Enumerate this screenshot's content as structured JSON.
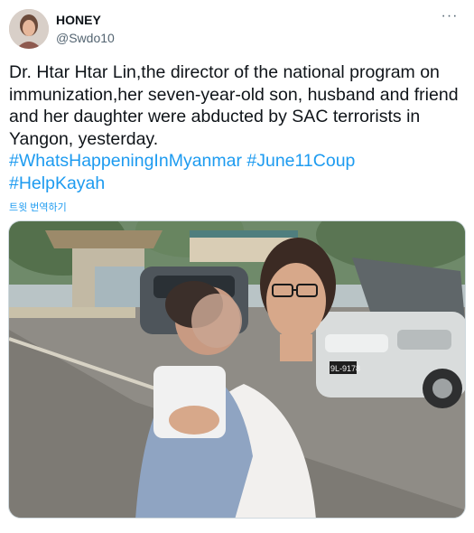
{
  "tweet": {
    "author_name": "HONEY",
    "author_handle": "@Swdo10",
    "more_icon": "more-horizontal-icon",
    "body_text": "Dr. Htar Htar Lin,the director of the national program on immunization,her seven-year-old son, husband and friend and her daughter were abducted by SAC terrorists in Yangon, yesterday.",
    "hashtags": [
      "#WhatsHappeningInMyanmar",
      "#June11Coup",
      "#HelpKayah"
    ],
    "translate_label": "트윗 번역하기",
    "media": {
      "plate_text": "9L-9178"
    }
  },
  "colors": {
    "link": "#1d9bf0",
    "secondary_text": "#536471",
    "primary_text": "#0f1419",
    "border": "#cfd9de"
  }
}
